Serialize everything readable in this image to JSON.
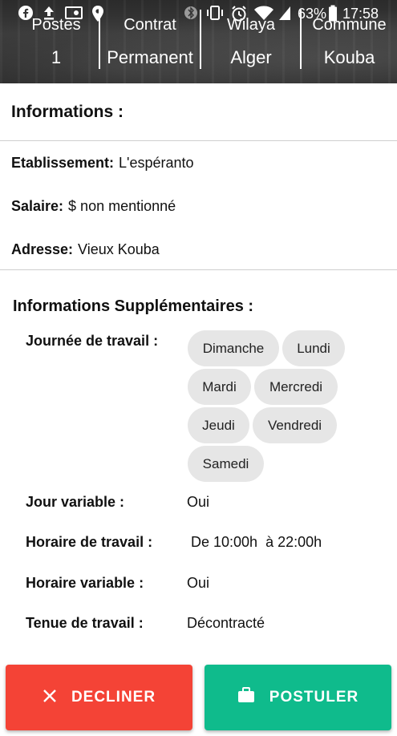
{
  "status_bar": {
    "battery": "63%",
    "time": "17:58",
    "icons": [
      "facebook-icon",
      "upload-icon",
      "cast-icon",
      "location-icon",
      "bluetooth-icon",
      "vibrate-icon",
      "alarm-icon",
      "wifi-icon",
      "signal-icon",
      "battery-icon"
    ]
  },
  "header": {
    "stats": [
      {
        "label": "Postes",
        "value": "1"
      },
      {
        "label": "Contrat",
        "value": "Permanent"
      },
      {
        "label": "Wilaya",
        "value": "Alger"
      },
      {
        "label": "Commune",
        "value": "Kouba"
      }
    ]
  },
  "informations": {
    "title": "Informations :",
    "etablissement": {
      "label": "Etablissement:",
      "value": "L'espéranto"
    },
    "salaire": {
      "label": "Salaire:",
      "value": "$ non mentionné"
    },
    "adresse": {
      "label": "Adresse:",
      "value": "Vieux Kouba"
    }
  },
  "supplementaires": {
    "title": "Informations Supplémentaires :",
    "journee": {
      "label": "Journée de travail :",
      "days": [
        "Dimanche",
        "Lundi",
        "Mardi",
        "Mercredi",
        "Jeudi",
        "Vendredi",
        "Samedi"
      ]
    },
    "jour_variable": {
      "label": "Jour variable :",
      "value": "Oui"
    },
    "horaire": {
      "label": "Horaire de travail :",
      "value": "De 10:00h  à 22:00h"
    },
    "horaire_variable": {
      "label": "Horaire variable :",
      "value": "Oui"
    },
    "tenue": {
      "label": "Tenue de travail :",
      "value": "Décontracté"
    }
  },
  "actions": {
    "decline_label": "DECLINER",
    "apply_label": "POSTULER",
    "decline_color": "#f44336",
    "apply_color": "#0fbb8c"
  }
}
